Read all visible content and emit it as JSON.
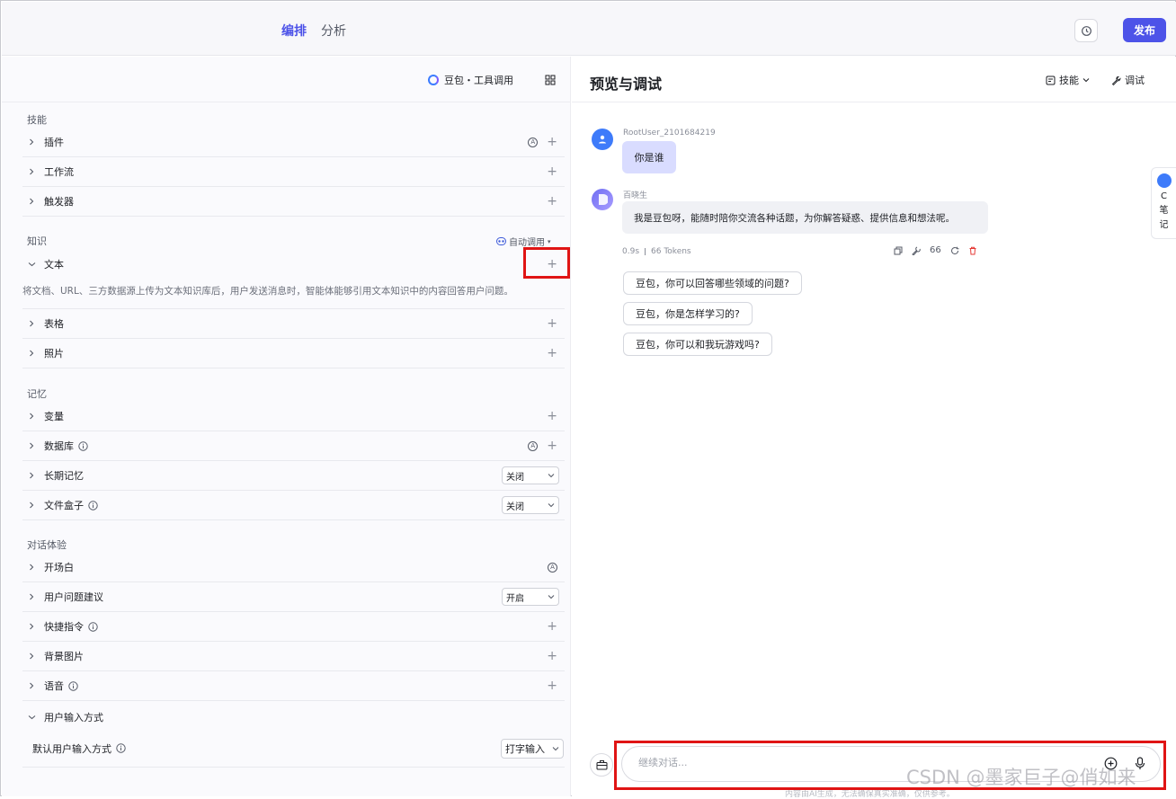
{
  "header": {
    "tabs": [
      {
        "label": "编排",
        "active": true
      },
      {
        "label": "分析",
        "active": false
      }
    ],
    "publish_label": "发布"
  },
  "left": {
    "model_name": "豆包・工具调用",
    "sections": {
      "skills": "技能",
      "knowledge": "知识",
      "memory": "记忆",
      "dialog": "对话体验"
    },
    "skills_rows": [
      "插件",
      "工作流",
      "触发器"
    ],
    "auto_call": "自动调用",
    "knowledge_rows": {
      "text": "文本",
      "text_desc": "将文档、URL、三方数据源上传为文本知识库后，用户发送消息时，智能体能够引用文本知识中的内容回答用户问题。",
      "table": "表格",
      "photo": "照片"
    },
    "memory_rows": {
      "variable": "变量",
      "database": "数据库",
      "long_term": "长期记忆",
      "long_term_value": "关闭",
      "filebox": "文件盒子",
      "filebox_value": "关闭"
    },
    "dialog_rows": {
      "opening": "开场白",
      "suggestion": "用户问题建议",
      "suggestion_value": "开启",
      "shortcut": "快捷指令",
      "background": "背景图片",
      "voice": "语音",
      "input_mode": "用户输入方式",
      "default_input_label": "默认用户输入方式",
      "default_input_value": "打字输入"
    },
    "accent_color": "#4d53e8"
  },
  "right": {
    "title": "预览与调试",
    "skill_btn": "技能",
    "debug_btn": "调试",
    "user_name": "RootUser_2101684219",
    "user_msg": "你是谁",
    "bot_name": "百晓生",
    "bot_msg": "我是豆包呀，能随时陪你交流各种话题，为你解答疑惑、提供信息和想法呢。",
    "latency": "0.9s",
    "tokens": "66 Tokens",
    "quote_count": "66",
    "suggestions": [
      "豆包，你可以回答哪些领域的问题?",
      "豆包，你是怎样学习的?",
      "豆包，你可以和我玩游戏吗?"
    ],
    "input_placeholder": "继续对话...",
    "footer_note": "内容由AI生成，无法确保真实准确，仅供参考。",
    "note_tab": [
      "C",
      "笔",
      "记"
    ]
  },
  "watermark": "CSDN @墨家巨子@俏如来",
  "highlight_color": "#e01414"
}
